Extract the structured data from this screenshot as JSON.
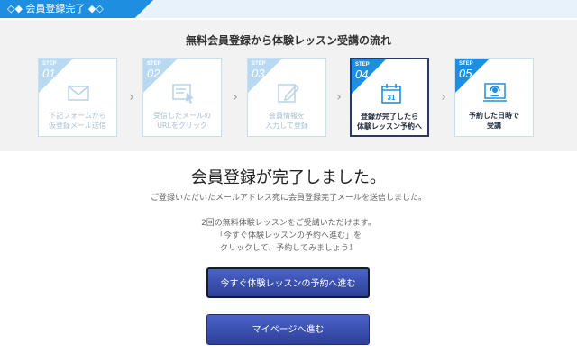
{
  "header": {
    "title": "◇◆ 会員登録完了 ◆◇"
  },
  "flow": {
    "title": "無料会員登録から体験レッスン受講の流れ",
    "step_word": "STEP",
    "steps": [
      {
        "num": "01",
        "label_line1": "下記フォームから",
        "label_line2": "仮登録メール送信",
        "icon": "envelope-icon"
      },
      {
        "num": "02",
        "label_line1": "受信したメールの",
        "label_line2": "URLをクリック",
        "icon": "click-icon"
      },
      {
        "num": "03",
        "label_line1": "会員情報を",
        "label_line2": "入力して登録",
        "icon": "pencil-icon"
      },
      {
        "num": "04",
        "label_line1": "登録が完了したら",
        "label_line2": "体験レッスン予約へ",
        "icon": "calendar-icon",
        "calendar_day": "31"
      },
      {
        "num": "05",
        "label_line1": "予約した日時で",
        "label_line2": "受講",
        "icon": "headset-icon"
      }
    ],
    "arrow": "›"
  },
  "main": {
    "title": "会員登録が完了しました。",
    "subtitle": "ご登録いただいたメールアドレス宛に会員登録完了メールを送信しました。",
    "info_line1": "2回の無料体験レッスンをご受講いただけます。",
    "info_line2": "「今すぐ体験レッスンの予約へ進む」を",
    "info_line3": "クリックして、予約してみましょう！"
  },
  "buttons": {
    "primary": "今すぐ体験レッスンの予約へ進む",
    "secondary": "マイページへ進む"
  },
  "colors": {
    "accent": "#1e8fe0",
    "button": "#3a4fb5",
    "inactive": "#b9d9f1"
  }
}
